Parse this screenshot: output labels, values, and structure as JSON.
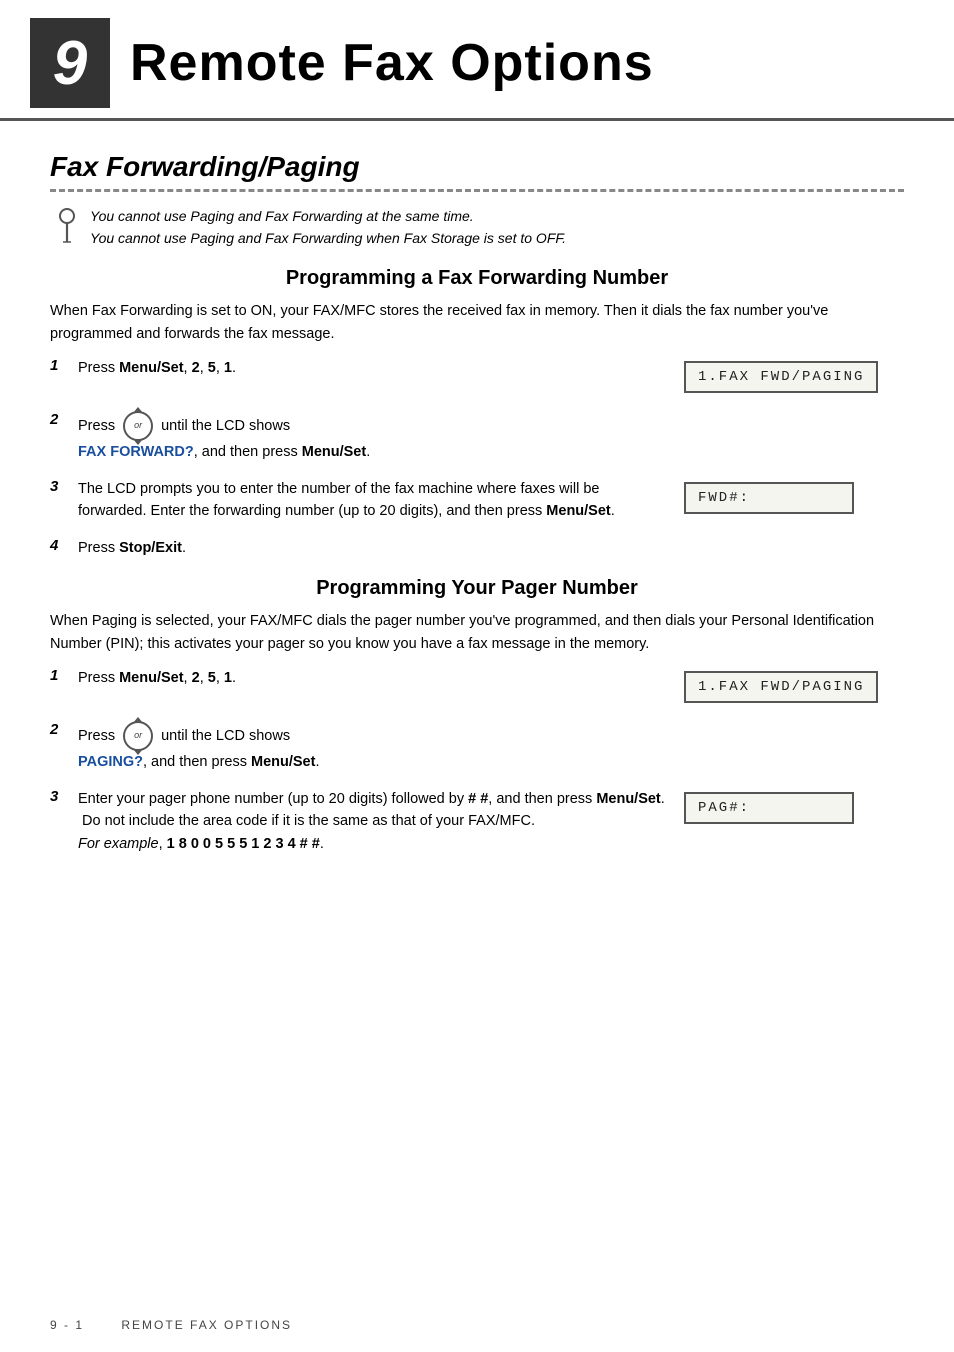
{
  "header": {
    "chapter_number": "9",
    "title": "Remote Fax Options"
  },
  "section1": {
    "heading": "Fax Forwarding/Paging",
    "note_line1": "You cannot use Paging and Fax Forwarding at the same time.",
    "note_line2": "You cannot use Paging and Fax Forwarding when Fax Storage is set to OFF.",
    "subsection1": {
      "heading": "Programming a Fax Forwarding Number",
      "intro": "When Fax Forwarding is set to ON, your FAX/MFC stores the received fax in memory. Then  it dials the fax number you've programmed and forwards the fax message.",
      "steps": [
        {
          "number": "1",
          "text_parts": [
            {
              "type": "text",
              "content": "Press "
            },
            {
              "type": "bold",
              "content": "Menu/Set"
            },
            {
              "type": "text",
              "content": ", "
            },
            {
              "type": "bold",
              "content": "2"
            },
            {
              "type": "text",
              "content": ", "
            },
            {
              "type": "bold",
              "content": "5"
            },
            {
              "type": "text",
              "content": ", "
            },
            {
              "type": "bold",
              "content": "1"
            },
            {
              "type": "text",
              "content": "."
            }
          ],
          "lcd": "1.FAX FWD/PAGING"
        },
        {
          "number": "2",
          "has_scroll": true,
          "text_line1": " until the LCD shows",
          "text_line2_color": "FAX FORWARD?",
          "text_line3": ", and then press ",
          "text_bold": "Menu/Set",
          "text_after": ".",
          "lcd": null
        },
        {
          "number": "3",
          "text_full": "The LCD prompts you to enter the number of the fax machine where faxes will be forwarded. Enter the forwarding number (up to 20 digits), and then press Menu/Set.",
          "lcd": "FWD#:"
        },
        {
          "number": "4",
          "text_parts": [
            {
              "type": "text",
              "content": "Press "
            },
            {
              "type": "bold",
              "content": "Stop/Exit"
            },
            {
              "type": "text",
              "content": "."
            }
          ],
          "lcd": null
        }
      ]
    },
    "subsection2": {
      "heading": "Programming Your Pager Number",
      "intro": "When Paging is selected, your FAX/MFC dials the pager number you've programmed, and then dials your Personal Identification Number (PIN); this activates your pager so you know you have a fax message in the memory.",
      "steps": [
        {
          "number": "1",
          "text_parts": [
            {
              "type": "text",
              "content": "Press "
            },
            {
              "type": "bold",
              "content": "Menu/Set"
            },
            {
              "type": "text",
              "content": ", "
            },
            {
              "type": "bold",
              "content": "2"
            },
            {
              "type": "text",
              "content": ", "
            },
            {
              "type": "bold",
              "content": "5"
            },
            {
              "type": "text",
              "content": ", "
            },
            {
              "type": "bold",
              "content": "1"
            },
            {
              "type": "text",
              "content": "."
            }
          ],
          "lcd": "1.FAX FWD/PAGING"
        },
        {
          "number": "2",
          "has_scroll": true,
          "text_line1": " until the LCD shows",
          "text_line2_color": "PAGING?",
          "text_line3": ", and then press ",
          "text_bold": "Menu/Set",
          "text_after": ".",
          "lcd": null
        },
        {
          "number": "3",
          "text_full": "Enter your pager phone number (up to 20 digits) followed by # #, and then press Menu/Set.  Do not include the area code if it is the same as that of your FAX/MFC.",
          "text_example": "For example, 1 8 0 0 5 5 5 1 2 3 4 # #.",
          "text_bold_in_full": "Menu/Set",
          "lcd": "PAG#:"
        }
      ]
    }
  },
  "footer": {
    "page": "9 - 1",
    "text": "REMOTE FAX OPTIONS"
  },
  "labels": {
    "press": "Press",
    "until_lcd": " until the LCD shows",
    "and_then_press": ", and then press ",
    "period": ".",
    "scroll_or": "or"
  }
}
